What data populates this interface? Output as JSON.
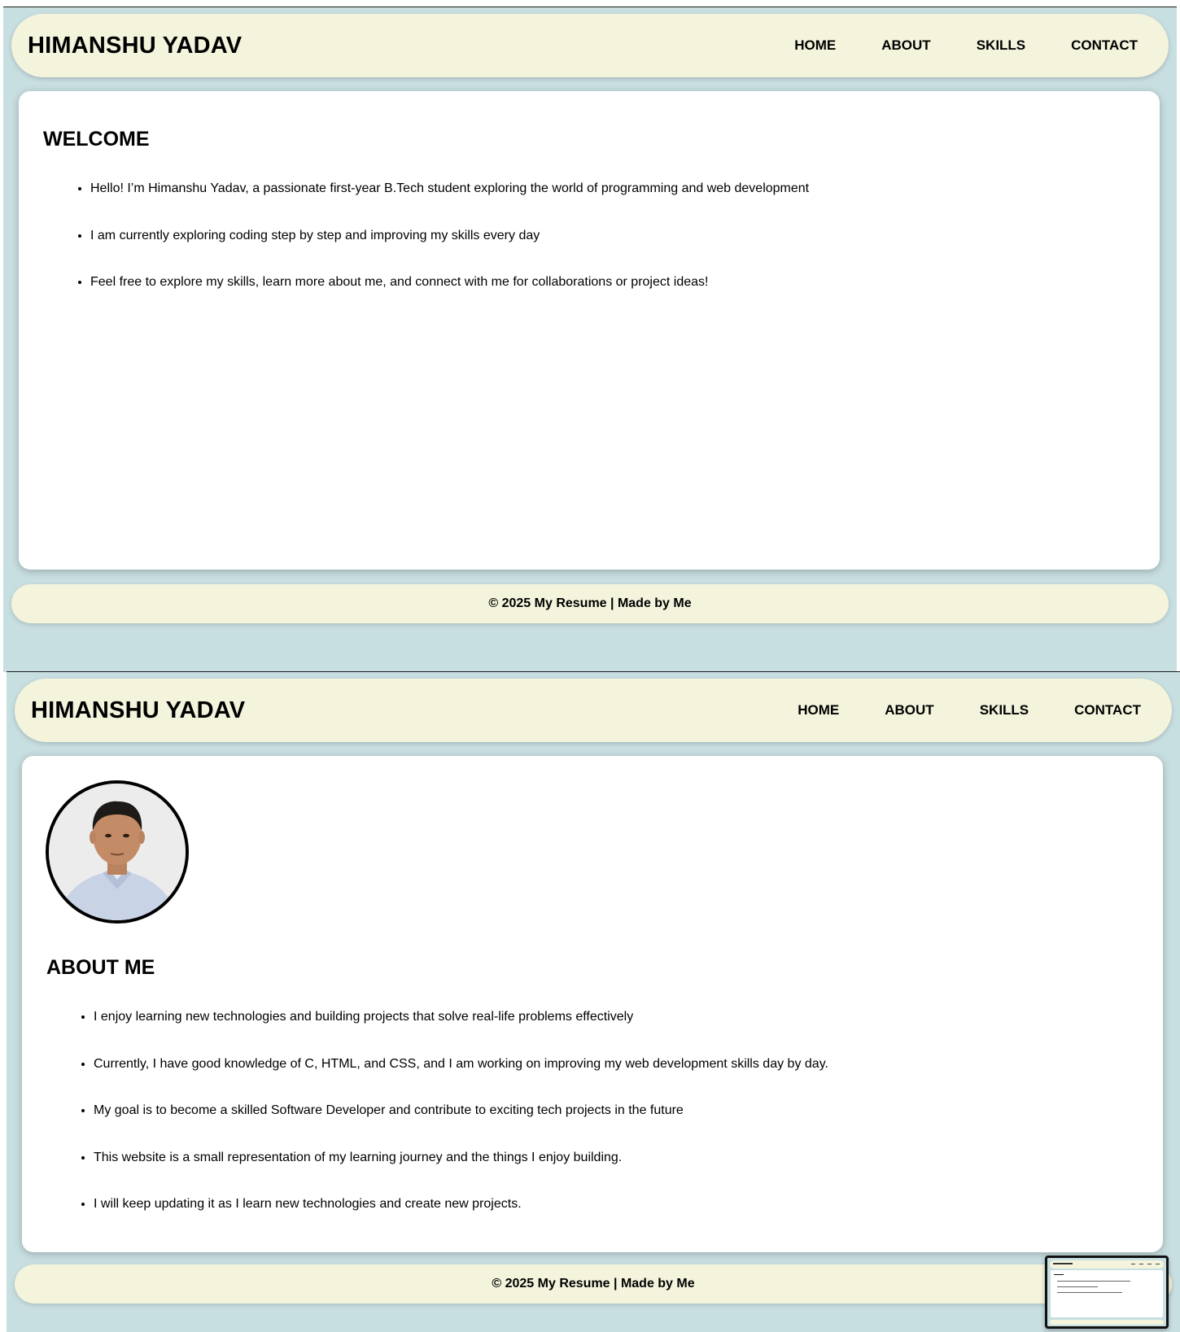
{
  "site": {
    "name": "HIMANSHU YADAV",
    "nav": [
      "HOME",
      "ABOUT",
      "SKILLS",
      "CONTACT"
    ],
    "footer": "© 2025 My Resume | Made by Me"
  },
  "home": {
    "heading": "WELCOME",
    "items": [
      "Hello! I’m Himanshu Yadav, a passionate first-year B.Tech student exploring the world of programming and web development",
      "I am currently exploring coding step by step and improving my skills every day",
      "Feel free to explore my skills, learn more about me, and connect with me for collaborations or project ideas!"
    ]
  },
  "about": {
    "heading": "ABOUT ME",
    "items": [
      "I enjoy learning new technologies and building projects that solve real-life problems effectively",
      "Currently, I have good knowledge of C, HTML, and CSS, and I am working on improving my web development skills day by day.",
      "My goal is to become a skilled Software Developer and contribute to exciting tech projects in the future",
      "This website is a small representation of my learning journey and the things I enjoy building.",
      "I will keep updating it as I learn new technologies and create new projects."
    ]
  },
  "colors": {
    "page_background": "#c8dfe1",
    "header_background": "#f4f4dd",
    "card_background": "#ffffff",
    "text": "#000000"
  },
  "icons": {
    "profile_photo": "profile-photo",
    "preview_thumbnail": "screenshot-thumbnail"
  }
}
